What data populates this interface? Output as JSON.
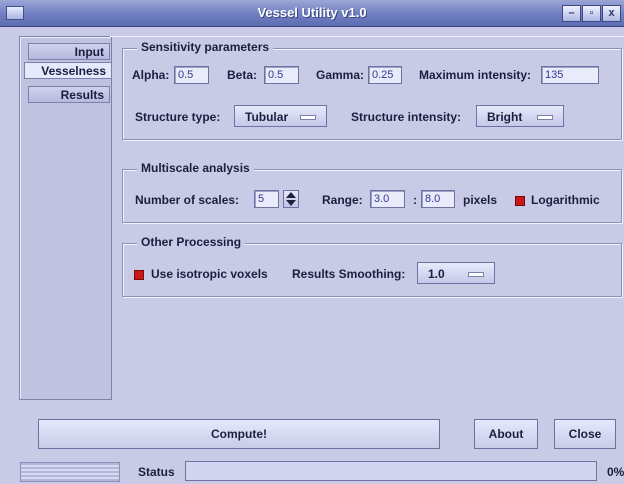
{
  "window": {
    "title": "Vessel Utility v1.0",
    "controls": {
      "minimize": "–",
      "maximize": "▫",
      "close": "x"
    }
  },
  "tabs": [
    {
      "label": "Input",
      "active": false
    },
    {
      "label": "Vesselness",
      "active": true
    },
    {
      "label": "Results",
      "active": false
    }
  ],
  "sensitivity": {
    "title": "Sensitivity parameters",
    "alpha_label": "Alpha:",
    "alpha_value": "0.5",
    "beta_label": "Beta:",
    "beta_value": "0.5",
    "gamma_label": "Gamma:",
    "gamma_value": "0.25",
    "max_intensity_label": "Maximum intensity:",
    "max_intensity_value": "135",
    "structure_type_label": "Structure type:",
    "structure_type_value": "Tubular",
    "structure_intensity_label": "Structure intensity:",
    "structure_intensity_value": "Bright"
  },
  "multiscale": {
    "title": "Multiscale analysis",
    "scales_label": "Number of scales:",
    "scales_value": "5",
    "range_label": "Range:",
    "range_min": "3.0",
    "range_sep": ":",
    "range_max": "8.0",
    "range_unit": "pixels",
    "logarithmic_label": "Logarithmic",
    "logarithmic_checked": true
  },
  "other": {
    "title": "Other Processing",
    "isotropic_label": "Use isotropic voxels",
    "isotropic_checked": true,
    "smoothing_label": "Results Smoothing:",
    "smoothing_value": "1.0"
  },
  "buttons": {
    "compute": "Compute!",
    "about": "About",
    "close": "Close"
  },
  "status": {
    "label": "Status",
    "percent": "0%",
    "progress": 0
  },
  "colors": {
    "checkbox": "#c81818",
    "titlebar": "#6f7fc0",
    "background": "#c9cbe6"
  }
}
